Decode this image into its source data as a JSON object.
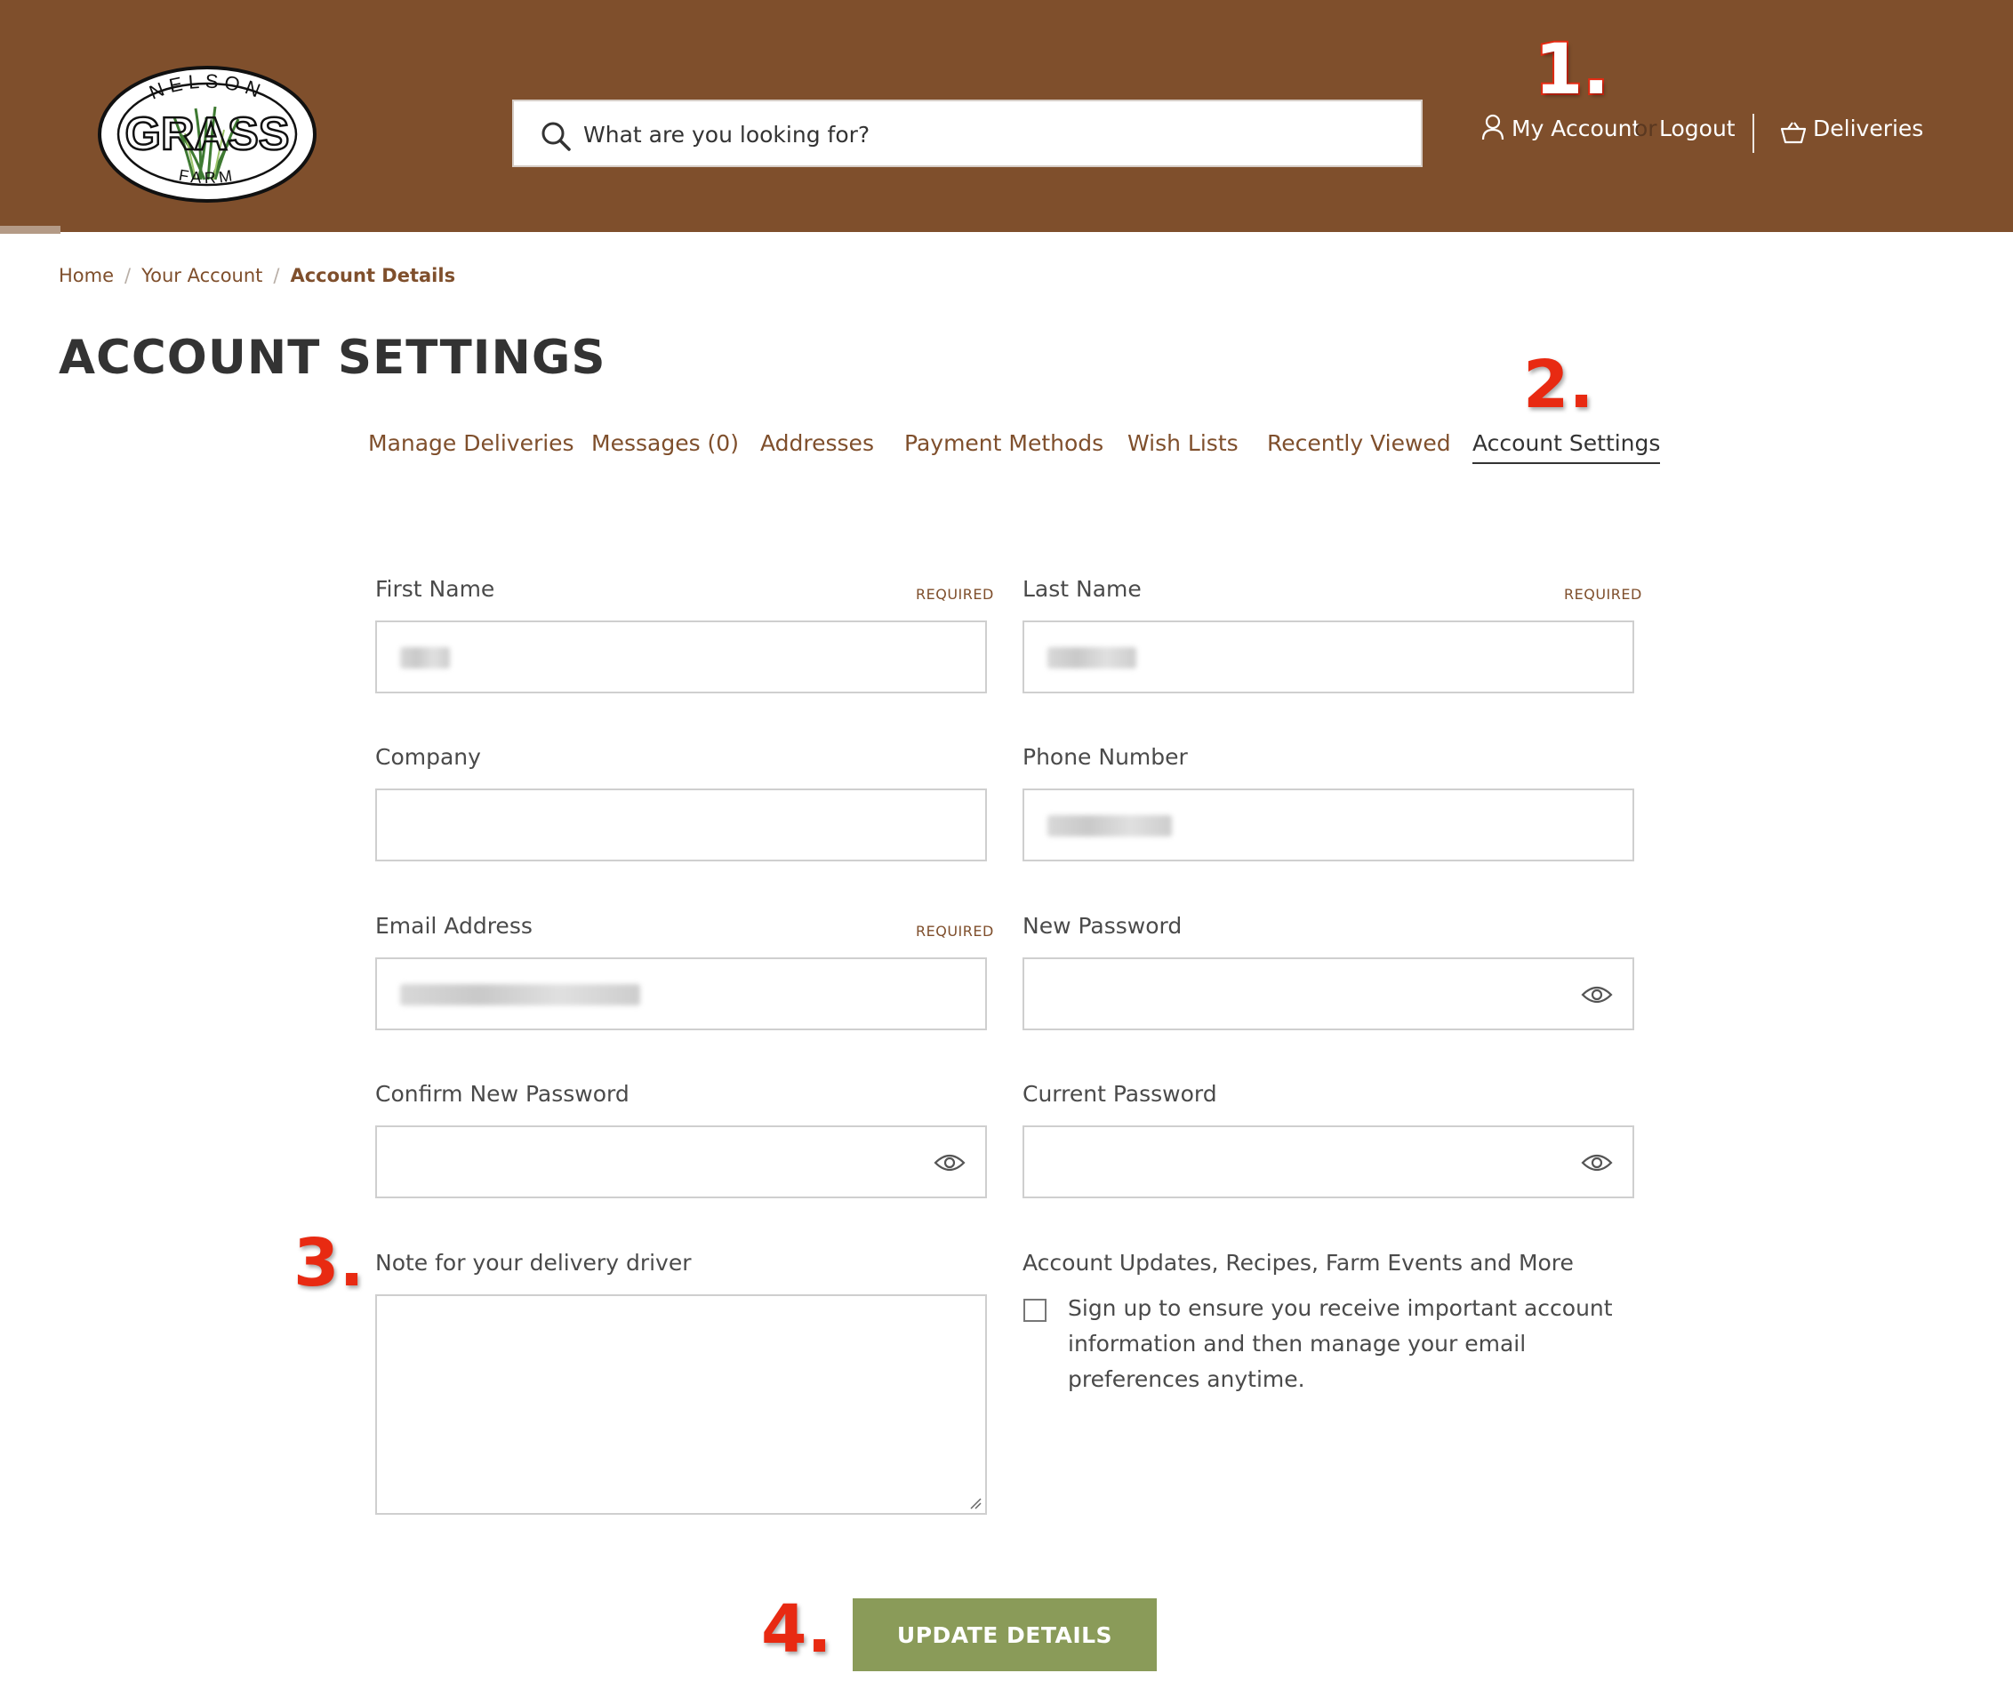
{
  "header": {
    "logo": {
      "top_text": "NELSON",
      "center_text": "GRASS",
      "bottom_text": "FARM"
    },
    "search": {
      "placeholder": "What are you looking for?"
    },
    "my_account": "My Account",
    "or_text": "or",
    "logout": "Logout",
    "deliveries": "Deliveries"
  },
  "annotations": {
    "step1": "1.",
    "step2": "2.",
    "step3": "3.",
    "step4": "4."
  },
  "breadcrumb": {
    "home": "Home",
    "your_account": "Your Account",
    "current": "Account Details"
  },
  "page_title": "ACCOUNT SETTINGS",
  "tabs": [
    {
      "label": "Manage Deliveries"
    },
    {
      "label": "Messages (0)"
    },
    {
      "label": "Addresses"
    },
    {
      "label": "Payment Methods"
    },
    {
      "label": "Wish Lists"
    },
    {
      "label": "Recently Viewed"
    },
    {
      "label": "Account Settings",
      "active": true
    }
  ],
  "form": {
    "required_text": "REQUIRED",
    "first_name": {
      "label": "First Name"
    },
    "last_name": {
      "label": "Last Name"
    },
    "company": {
      "label": "Company"
    },
    "phone": {
      "label": "Phone Number"
    },
    "email": {
      "label": "Email Address"
    },
    "new_password": {
      "label": "New Password"
    },
    "confirm_password": {
      "label": "Confirm New Password"
    },
    "current_password": {
      "label": "Current Password"
    },
    "note": {
      "label": "Note for your delivery driver"
    },
    "newsletter": {
      "label": "Account Updates, Recipes, Farm Events and More",
      "checkbox_text": "Sign up to ensure you receive important account information and then manage your email preferences anytime.",
      "checked": false
    },
    "submit": "UPDATE DETAILS"
  },
  "colors": {
    "header_bg": "#7f4f2c",
    "button_bg": "#8a9b59",
    "annotation": "#e82a12"
  }
}
